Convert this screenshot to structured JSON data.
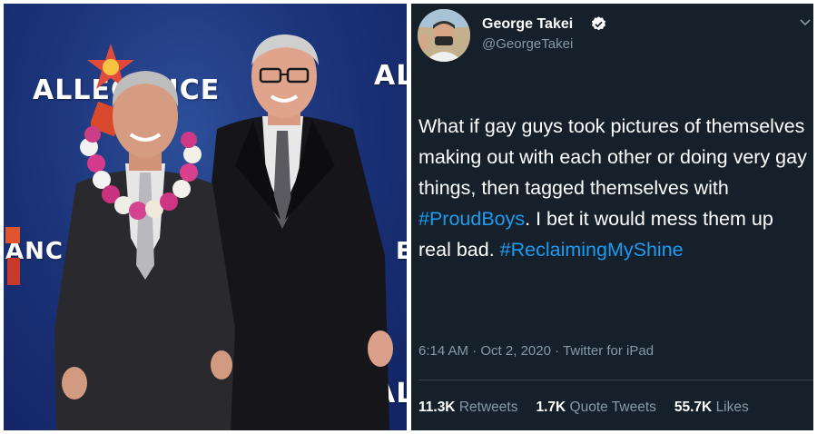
{
  "photo": {
    "backdrop_texts": [
      "ALLEG",
      "ICE",
      "AL",
      "ANC",
      "E",
      "AL",
      "CE"
    ]
  },
  "tweet": {
    "display_name": "George Takei",
    "handle": "@GeorgeTakei",
    "text_parts": [
      "What if gay guys took pictures of themselves making out with each other or doing very gay things, then tagged themselves with ",
      "#ProudBoys",
      ". I bet it would mess them up real bad. ",
      "#ReclaimingMyShine"
    ],
    "time": "6:14 AM",
    "date": "Oct 2, 2020",
    "source": "Twitter for iPad",
    "separator": "·",
    "retweets": {
      "count": "11.3K",
      "label": "Retweets"
    },
    "quote_tweets": {
      "count": "1.7K",
      "label": "Quote Tweets"
    },
    "likes": {
      "count": "55.7K",
      "label": "Likes"
    },
    "colors": {
      "background": "#15202b",
      "link": "#1d9bf0",
      "muted": "#8899a6",
      "verified": "#ffffff"
    },
    "icons": [
      "verified-badge-icon",
      "chevron-down-icon"
    ]
  }
}
